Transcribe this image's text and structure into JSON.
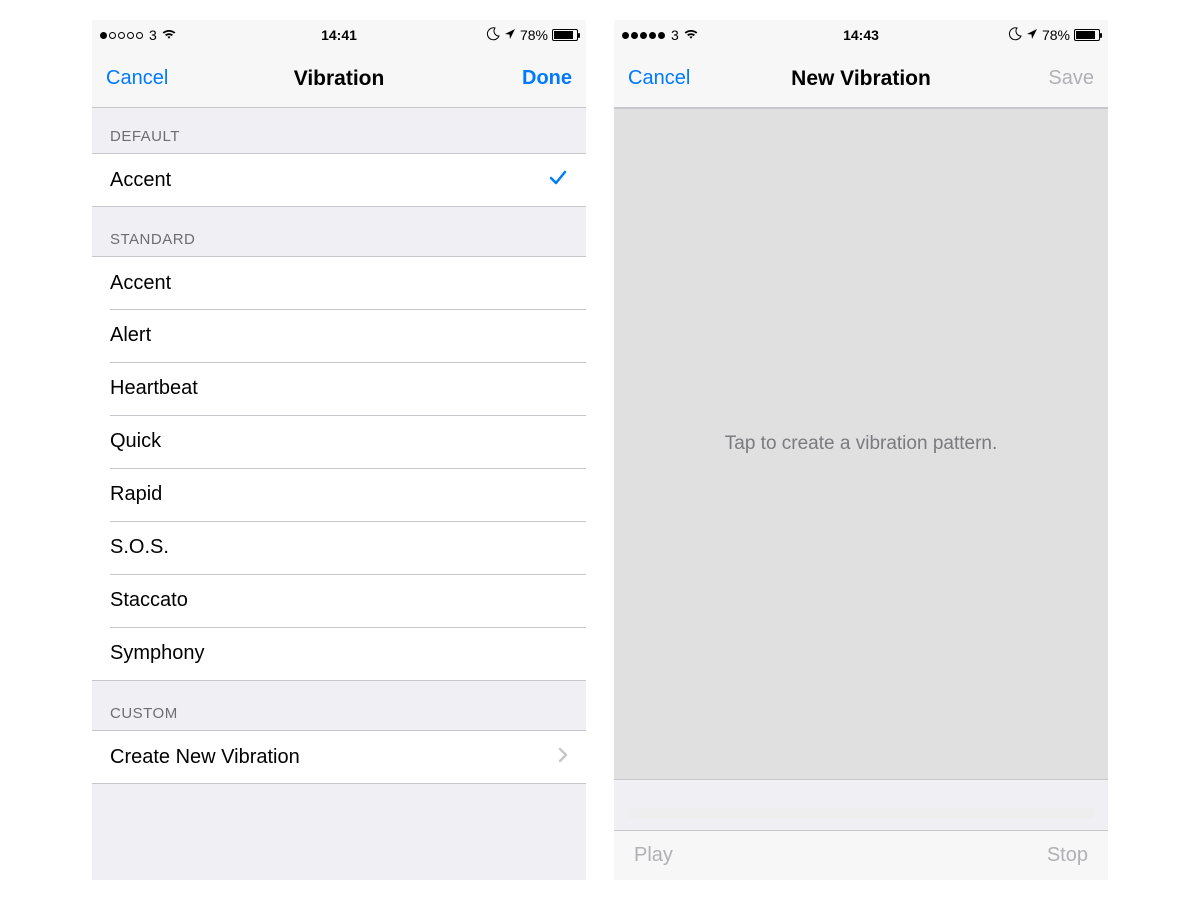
{
  "left": {
    "status": {
      "carrier": "3",
      "time": "14:41",
      "battery_pct": "78%",
      "signal_filled": 1
    },
    "nav": {
      "left": "Cancel",
      "title": "Vibration",
      "right": "Done"
    },
    "sections": {
      "default_header": "DEFAULT",
      "default_items": [
        "Accent"
      ],
      "standard_header": "STANDARD",
      "standard_items": [
        "Accent",
        "Alert",
        "Heartbeat",
        "Quick",
        "Rapid",
        "S.O.S.",
        "Staccato",
        "Symphony"
      ],
      "custom_header": "CUSTOM",
      "custom_items": [
        "Create New Vibration"
      ]
    }
  },
  "right": {
    "status": {
      "carrier": "3",
      "time": "14:43",
      "battery_pct": "78%",
      "signal_filled": 5
    },
    "nav": {
      "left": "Cancel",
      "title": "New Vibration",
      "right": "Save"
    },
    "body": {
      "hint": "Tap to create a vibration pattern."
    },
    "toolbar": {
      "play": "Play",
      "stop": "Stop"
    }
  }
}
